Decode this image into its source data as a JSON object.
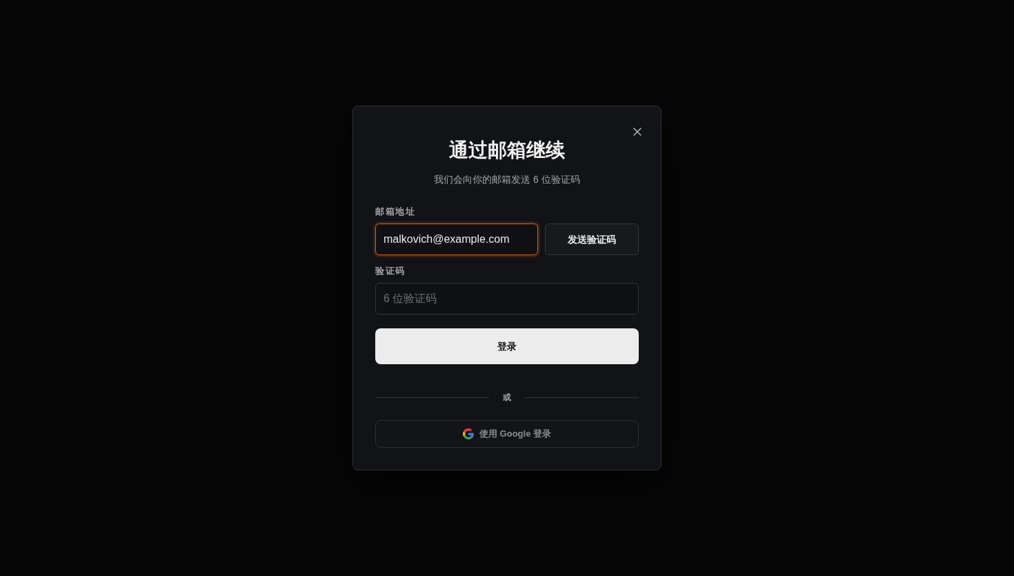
{
  "dialog": {
    "title": "通过邮箱继续",
    "subtitle": "我们会向你的邮箱发送 6 位验证码",
    "fields": [
      {
        "label": "邮箱地址",
        "value": "malkovich@example.com",
        "focused": true,
        "action": "发送验证码"
      },
      {
        "label": "验证码",
        "placeholder": "6 位验证码",
        "focused": false
      }
    ],
    "submit": "登录",
    "divider": "或",
    "google_button": "使用 Google 登录"
  }
}
